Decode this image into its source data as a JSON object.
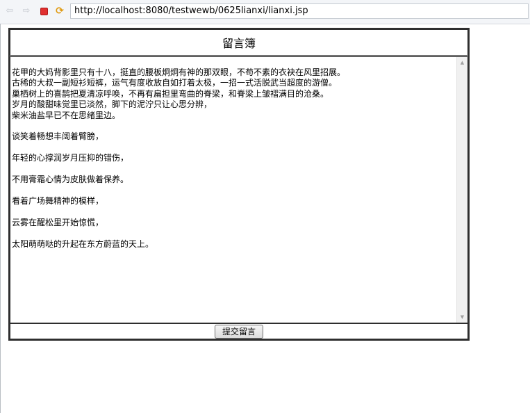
{
  "browser": {
    "url": "http://localhost:8080/testwewb/0625lianxi/lianxi.jsp",
    "icons": {
      "back": "arrow-left-icon",
      "forward": "arrow-right-icon",
      "stop": "stop-icon",
      "refresh": "refresh-icon"
    },
    "colors": {
      "stop": "#e03030",
      "refresh": "#e09a10"
    }
  },
  "guestbook": {
    "title": "留言簿",
    "message": "花甲的大妈背影里只有十八，挺直的腰板炯炯有神的那双眼，不苟不素的衣袂在风里招展。\n古稀的大叔一副短衫短裤，运气有度收放自如打着太极，一招一式活脱武当超度的游僧。\n巢栖树上的喜鹊把夏清凉呼唤，不再有扁担里弯曲的脊梁，和脊梁上皱褶满目的沧桑。\n岁月的酸甜味觉里已淡然，脚下的泥泞只让心思分辨，\n柴米油盐早已不在思绪里边。\n\n谈笑着畅想丰阔着臂膀，\n\n年轻的心撑润岁月压抑的错伤，\n\n不用膏霜心情为皮肤做着保养。\n\n看着广场舞精神的模样，\n\n云雾在醒松里开始惊慌，\n\n太阳萌萌哒的升起在东方蔚蓝的天上。",
    "submit_label": "提交留言"
  }
}
